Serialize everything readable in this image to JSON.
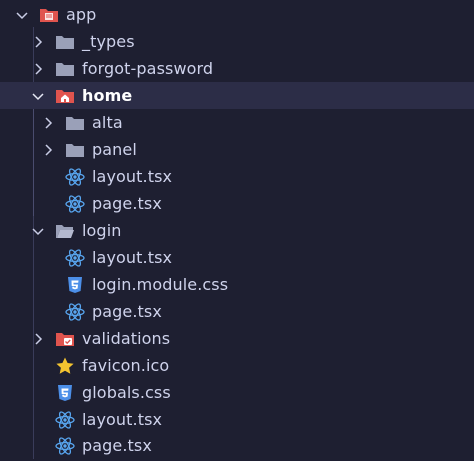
{
  "explorer": {
    "items": [
      {
        "label": "app",
        "icon": "folder-app-icon",
        "chevron": "down"
      },
      {
        "label": "_types",
        "icon": "folder-icon",
        "chevron": "right"
      },
      {
        "label": "forgot-password",
        "icon": "folder-icon",
        "chevron": "right"
      },
      {
        "label": "home",
        "icon": "folder-home-icon",
        "chevron": "down",
        "selected": true
      },
      {
        "label": "alta",
        "icon": "folder-icon",
        "chevron": "right"
      },
      {
        "label": "panel",
        "icon": "folder-icon",
        "chevron": "right"
      },
      {
        "label": "layout.tsx",
        "icon": "react-icon"
      },
      {
        "label": "page.tsx",
        "icon": "react-icon"
      },
      {
        "label": "login",
        "icon": "folder-open-icon",
        "chevron": "down"
      },
      {
        "label": "layout.tsx",
        "icon": "react-icon"
      },
      {
        "label": "login.module.css",
        "icon": "css-icon"
      },
      {
        "label": "page.tsx",
        "icon": "react-icon"
      },
      {
        "label": "validations",
        "icon": "folder-validation-icon",
        "chevron": "right"
      },
      {
        "label": "favicon.ico",
        "icon": "star-icon"
      },
      {
        "label": "globals.css",
        "icon": "css-icon"
      },
      {
        "label": "layout.tsx",
        "icon": "react-icon"
      },
      {
        "label": "page.tsx",
        "icon": "react-icon"
      }
    ]
  },
  "colors": {
    "background": "#1e1f31",
    "selected_row": "#2c2d47",
    "folder_gray": "#9aa0b8",
    "folder_red": "#e0544e",
    "react_blue": "#58a6f0",
    "css_blue": "#4c8fe8",
    "star_yellow": "#f4c430"
  }
}
